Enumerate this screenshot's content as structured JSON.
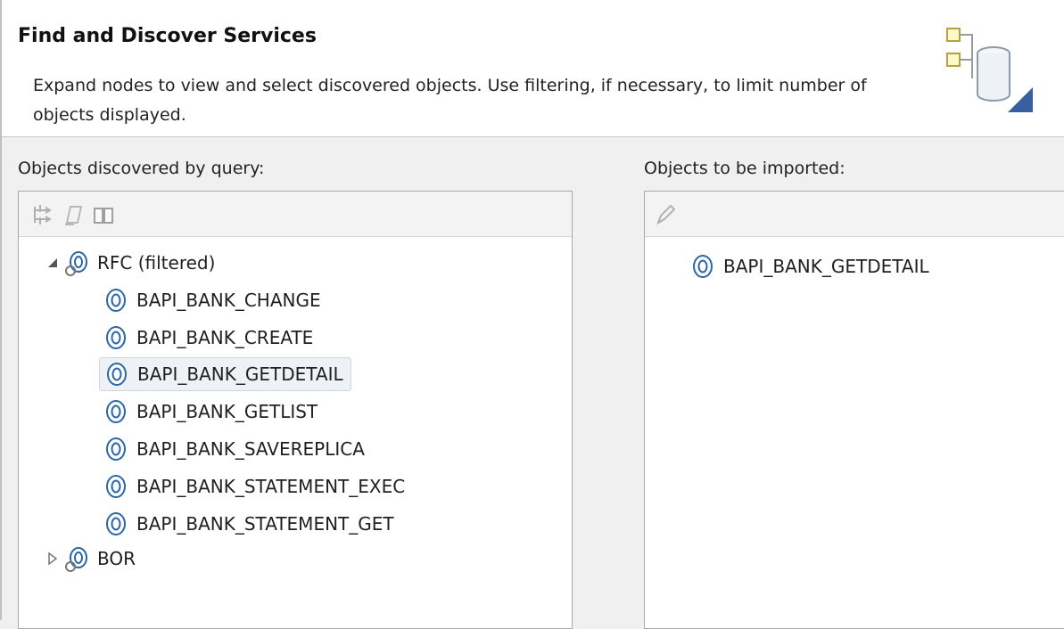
{
  "header": {
    "title": "Find and Discover Services",
    "description": "Expand nodes to view and select discovered objects. Use filtering, if necessary, to limit number of objects displayed."
  },
  "left_panel": {
    "label": "Objects discovered by query:",
    "toolbar_icons": [
      "filter-icon",
      "edit-icon",
      "book-icon"
    ],
    "tree": {
      "rfc": {
        "label": "RFC (filtered)",
        "expanded": true,
        "children": [
          "BAPI_BANK_CHANGE",
          "BAPI_BANK_CREATE",
          "BAPI_BANK_GETDETAIL",
          "BAPI_BANK_GETLIST",
          "BAPI_BANK_SAVEREPLICA",
          "BAPI_BANK_STATEMENT_EXEC",
          "BAPI_BANK_STATEMENT_GET"
        ],
        "selected": "BAPI_BANK_GETDETAIL"
      },
      "bor": {
        "label": "BOR",
        "expanded": false
      }
    }
  },
  "right_panel": {
    "label": "Objects to be imported:",
    "toolbar_icons": [
      "edit-icon"
    ],
    "items": [
      "BAPI_BANK_GETDETAIL"
    ]
  },
  "colors": {
    "accent": "#1f5fa8",
    "selection": "#eef1f5"
  }
}
